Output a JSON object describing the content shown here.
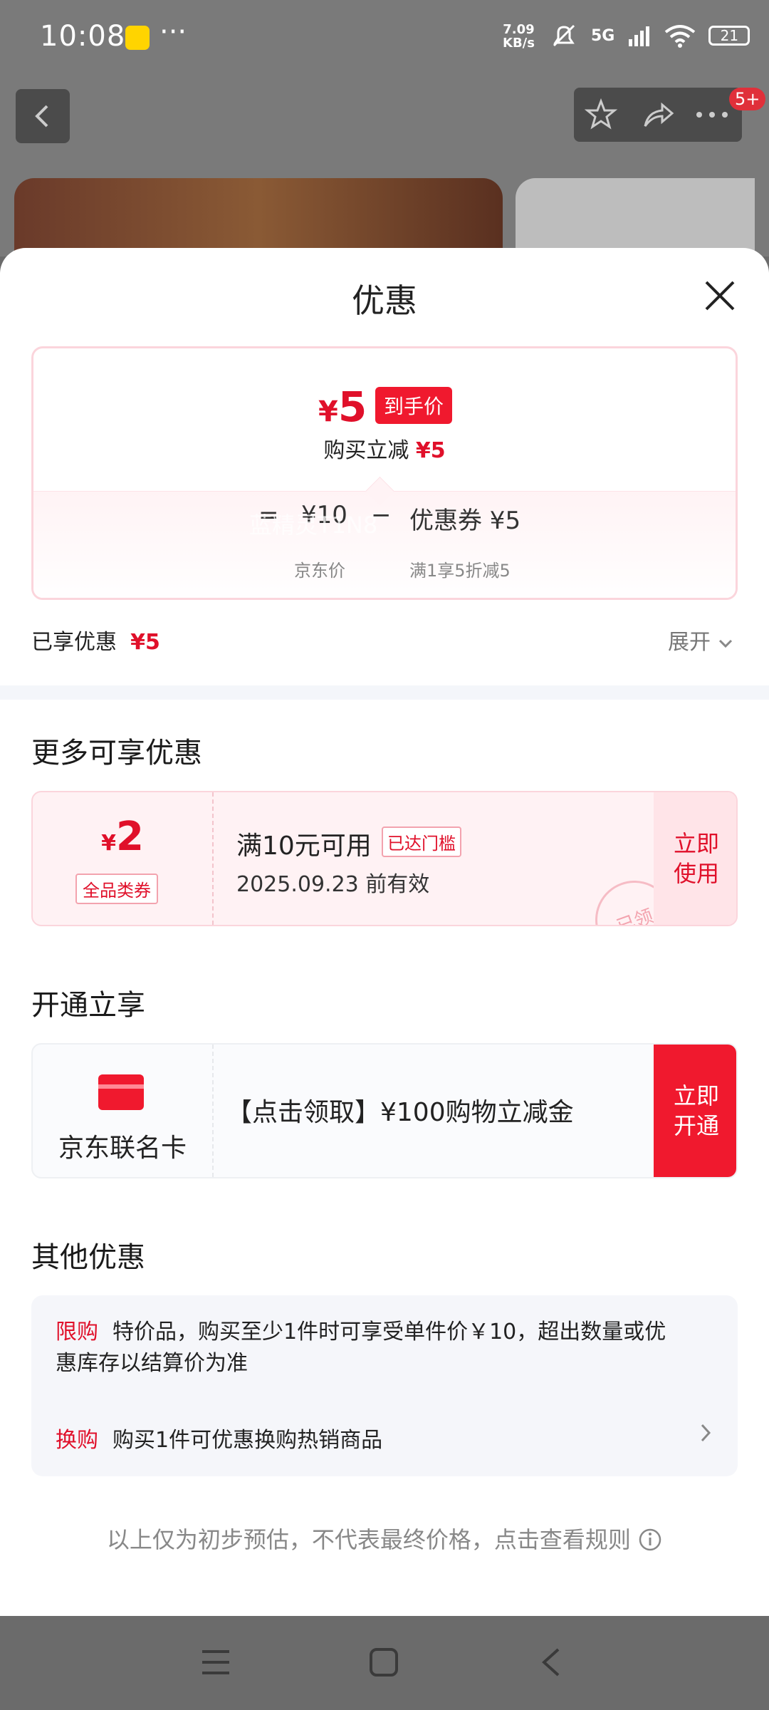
{
  "status_bar": {
    "time": "10:08",
    "net_speed_value": "7.09",
    "net_speed_unit": "KB/s",
    "network": "5G",
    "battery": "21"
  },
  "background": {
    "notification_badge": "5+"
  },
  "sheet": {
    "title": "优惠",
    "price_summary": {
      "final_price": "5",
      "final_price_tag": "到手价",
      "reduction_text": "购买立减",
      "reduction_amount": "¥5",
      "equals": "=",
      "jd_price": "¥10",
      "minus": "−",
      "coupon_label": "优惠券 ¥5",
      "jd_price_caption": "京东价",
      "coupon_caption": "满1享5折减5"
    },
    "enjoyed_label": "已享优惠",
    "enjoyed_amount": "¥5",
    "expand_label": "展开",
    "more_section_title": "更多可享优惠",
    "coupon": {
      "amount": "2",
      "type": "全品类券",
      "condition": "满10元可用",
      "status": "已达门槛",
      "expiry": "2025.09.23 前有效",
      "button": "立即使用",
      "stamp": "已领"
    },
    "watermark": "蓝精灵T1N8",
    "open_section_title": "开通立享",
    "jd_card": {
      "name": "京东联名卡",
      "offer": "【点击领取】¥100购物立减金",
      "button": "立即开通"
    },
    "other_section_title": "其他优惠",
    "other": {
      "limit_label": "限购",
      "limit_text": "特价品，购买至少1件时可享受单件价￥10，超出数量或优惠库存以结算价为准",
      "swap_label": "换购",
      "swap_text": "购买1件可优惠换购热销商品"
    },
    "footnote": "以上仅为初步预估，不代表最终价格，点击查看规则"
  }
}
